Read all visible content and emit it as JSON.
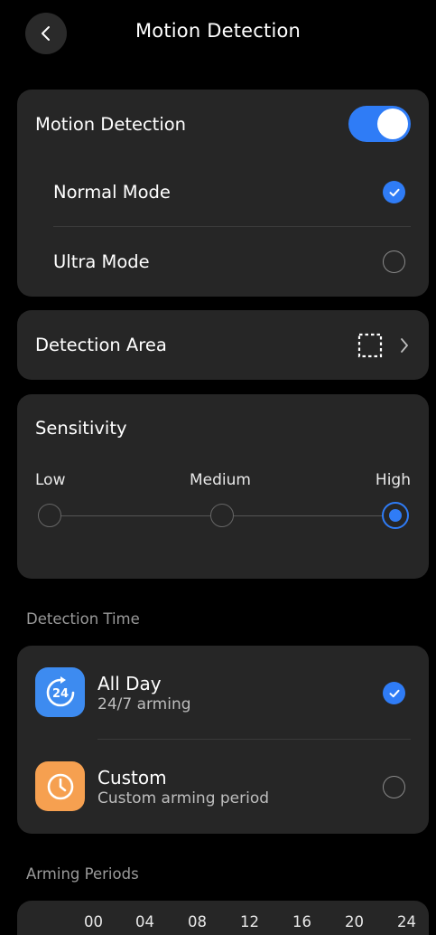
{
  "header": {
    "title": "Motion Detection",
    "back_icon": "chevron-left-icon"
  },
  "motion_card": {
    "toggle_label": "Motion Detection",
    "toggle_on": true,
    "modes": [
      {
        "label": "Normal Mode",
        "selected": true
      },
      {
        "label": "Ultra Mode",
        "selected": false
      }
    ]
  },
  "detection_area": {
    "label": "Detection Area",
    "icon": "dashed-square-icon"
  },
  "sensitivity": {
    "label": "Sensitivity",
    "levels": [
      "Low",
      "Medium",
      "High"
    ],
    "selected": "High"
  },
  "detection_time": {
    "section_label": "Detection Time",
    "options": [
      {
        "title": "All Day",
        "subtitle": "24/7 arming",
        "icon": "24h-cycle-icon",
        "selected": true
      },
      {
        "title": "Custom",
        "subtitle": "Custom arming period",
        "icon": "clock-icon",
        "selected": false
      }
    ]
  },
  "arming_periods": {
    "section_label": "Arming Periods",
    "hours": [
      "00",
      "04",
      "08",
      "12",
      "16",
      "20",
      "24"
    ]
  },
  "colors": {
    "accent": "#2f7cf6",
    "card": "#262626",
    "background": "#000000",
    "allday_icon": "#3d8bf0",
    "custom_icon": "#f6a050"
  }
}
